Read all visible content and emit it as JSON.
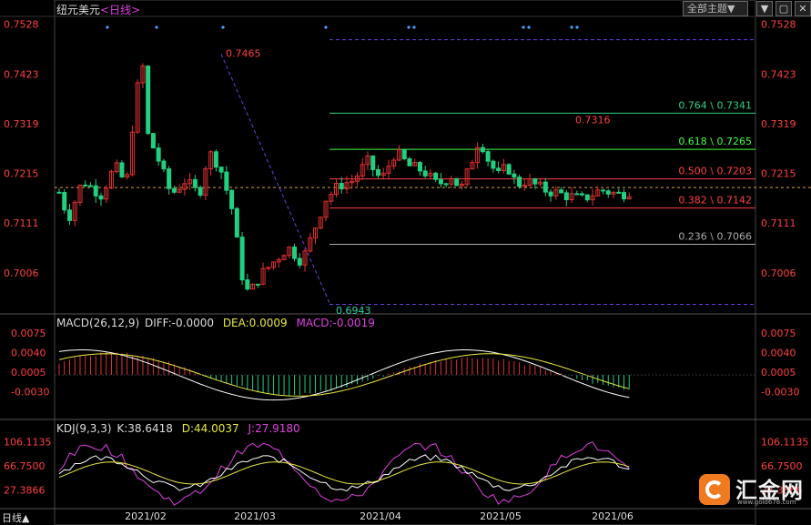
{
  "window": {
    "symbol": "纽元美元",
    "timeframe": "<日线>",
    "dropdown": "全部主题▼",
    "period_tab": "日线▲",
    "buttons": [
      "▼",
      "▢",
      "✕"
    ]
  },
  "colors": {
    "up": "#e03030",
    "down": "#20d080",
    "price_axis": "#ff4040",
    "bg": "#000000"
  },
  "chart_data": {
    "type": "candlestick",
    "price_axis_labels": [
      "0.7528",
      "0.7423",
      "0.7319",
      "0.7215",
      "0.7111",
      "0.7006"
    ],
    "ylim": [
      0.692,
      0.754
    ],
    "date_labels": [
      "2021/02",
      "2021/03",
      "2021/04",
      "2021/05",
      "2021/06"
    ],
    "annotations": {
      "high": "0.7465",
      "low": "0.6943",
      "recent_high": "0.7316"
    },
    "fibonacci": [
      {
        "label": "0.764 \\ 0.7341",
        "value": 0.7341,
        "color": "#30d080"
      },
      {
        "label": "0.618 \\ 0.7265",
        "value": 0.7265,
        "color": "#40ff40"
      },
      {
        "label": "0.500 \\ 0.7203",
        "value": 0.7203,
        "color": "#ff4040"
      },
      {
        "label": "0.382 \\ 0.7142",
        "value": 0.7142,
        "color": "#ff4040"
      },
      {
        "label": "0.236 \\ 0.7066",
        "value": 0.7066,
        "color": "#aaaaaa"
      }
    ],
    "current_price": 0.7185,
    "macd": {
      "header": "MACD(26,12,9)",
      "diff": "DIFF:-0.0000",
      "dea": "DEA:0.0009",
      "macd": "MACD:-0.0019",
      "axis_labels": [
        "0.0075",
        "0.0040",
        "0.0005",
        "-0.0030"
      ],
      "ylim": [
        -0.0075,
        0.0085
      ]
    },
    "kdj": {
      "header": "KDJ(9,3,3)",
      "k": "K:38.6418",
      "d": "D:44.0037",
      "j": "J:27.9180",
      "axis_labels": [
        "106.1135",
        "66.7500",
        "27.3866"
      ],
      "ylim": [
        0,
        120
      ]
    }
  },
  "logo": {
    "name": "汇金网",
    "url": "www.gold678.com"
  }
}
